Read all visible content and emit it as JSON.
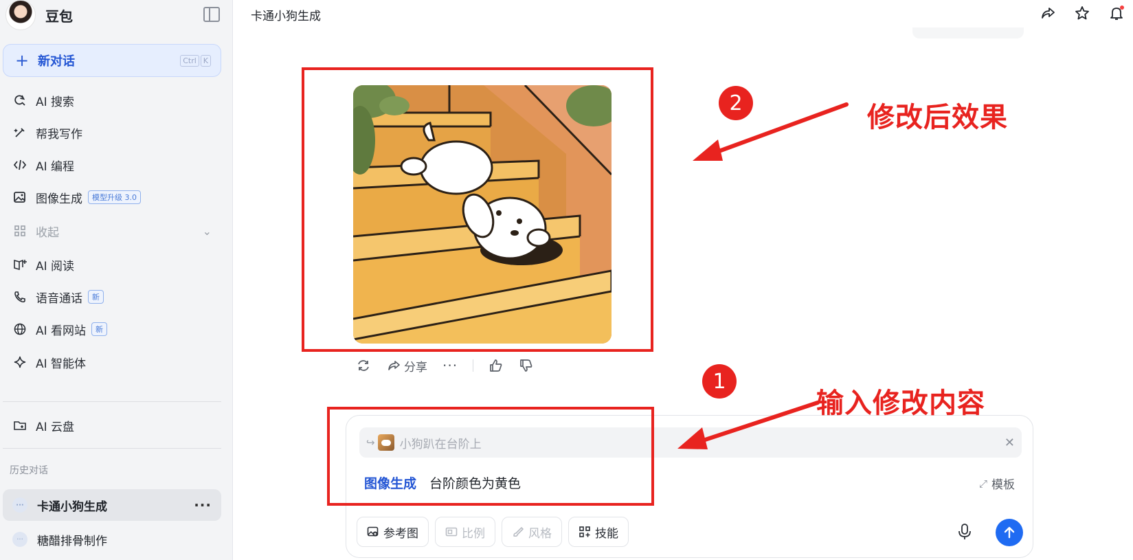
{
  "sidebar": {
    "brand_name": "豆包",
    "new_chat": {
      "label": "新对话",
      "shortcut_keys": [
        "Ctrl",
        "K"
      ]
    },
    "items": [
      {
        "label": "AI 搜索",
        "icon": "search-refresh-icon"
      },
      {
        "label": "帮我写作",
        "icon": "pen-sparkle-icon"
      },
      {
        "label": "AI 编程",
        "icon": "code-icon"
      },
      {
        "label": "图像生成",
        "icon": "image-icon",
        "tag": "模型升级 3.0"
      },
      {
        "label": "收起",
        "icon": "grid-icon"
      },
      {
        "label": "AI 阅读",
        "icon": "book-icon"
      },
      {
        "label": "语音通话",
        "icon": "phone-icon",
        "tag": "新"
      },
      {
        "label": "AI 看网站",
        "icon": "globe-icon",
        "tag": "新"
      },
      {
        "label": "AI 智能体",
        "icon": "sparkle-icon"
      },
      {
        "label": "AI 云盘",
        "icon": "folder-icon"
      }
    ],
    "history_title": "历史对话",
    "history": [
      {
        "label": "卡通小狗生成",
        "active": true
      },
      {
        "label": "糖醋排骨制作",
        "active": false
      }
    ]
  },
  "header": {
    "title": "卡通小狗生成"
  },
  "message": {
    "actions": {
      "share_label": "分享"
    }
  },
  "annotations": {
    "step1": {
      "number": "1",
      "text": "输入修改内容"
    },
    "step2": {
      "number": "2",
      "text": "修改后效果"
    },
    "color": "#e8231f"
  },
  "composer": {
    "reference_text": "小狗趴在台阶上",
    "skill_label": "图像生成",
    "prompt": "台阶颜色为黄色",
    "template_label": "模板",
    "chips": [
      {
        "label": "参考图",
        "enabled": true
      },
      {
        "label": "比例",
        "enabled": false
      },
      {
        "label": "风格",
        "enabled": false
      },
      {
        "label": "技能",
        "enabled": true
      }
    ],
    "send_color": "#1f6bf2"
  }
}
